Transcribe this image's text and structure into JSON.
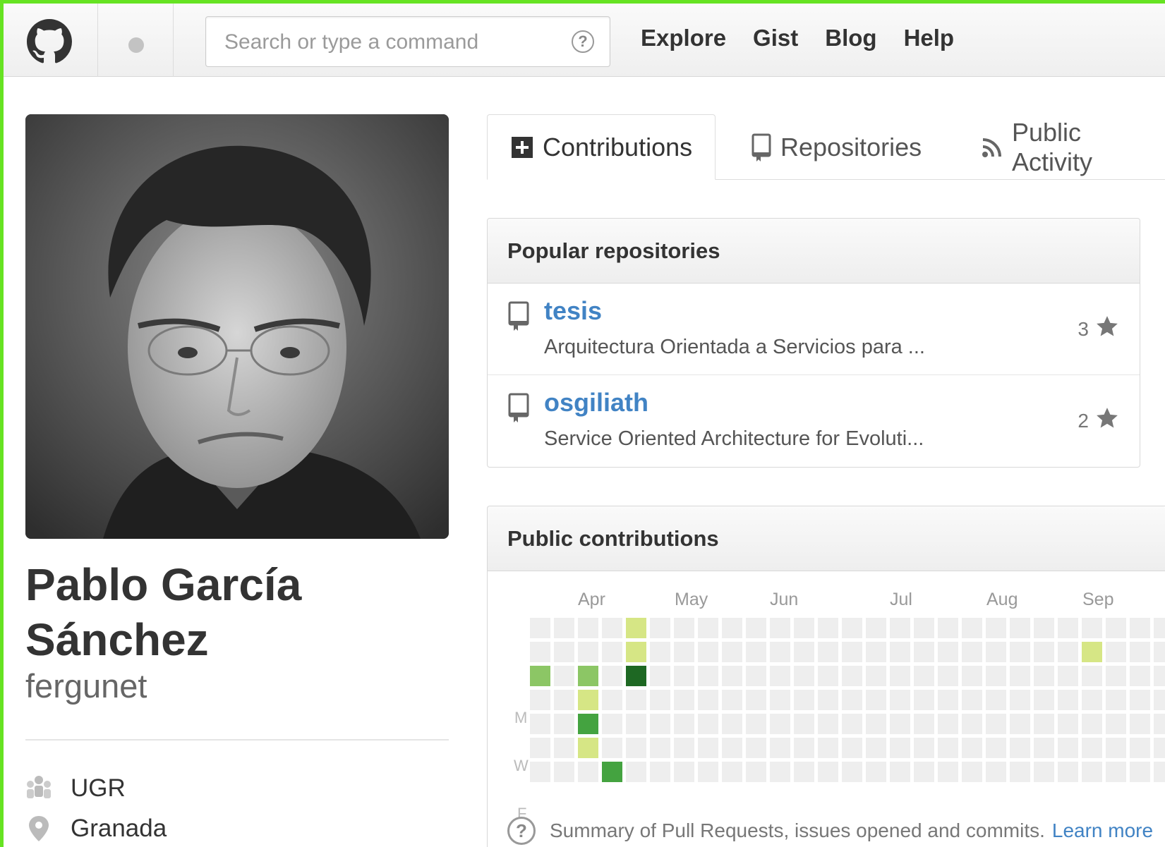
{
  "header": {
    "search_placeholder": "Search or type a command",
    "nav": [
      "Explore",
      "Gist",
      "Blog",
      "Help"
    ]
  },
  "profile": {
    "fullname_line1": "Pablo García",
    "fullname_line2": "Sánchez",
    "username": "fergunet",
    "details": [
      {
        "icon": "organization-icon",
        "text": "UGR"
      },
      {
        "icon": "location-icon",
        "text": "Granada"
      }
    ]
  },
  "tabs": [
    {
      "label": "Contributions",
      "icon": "plus-square-icon",
      "active": true
    },
    {
      "label": "Repositories",
      "icon": "repo-icon",
      "active": false
    },
    {
      "label": "Public Activity",
      "icon": "rss-icon",
      "active": false
    }
  ],
  "popular": {
    "title": "Popular repositories",
    "repos": [
      {
        "name": "tesis",
        "description": "Arquitectura Orientada a Servicios para ...",
        "stars": "3"
      },
      {
        "name": "osgiliath",
        "description": "Service Oriented Architecture for Evoluti...",
        "stars": "2"
      }
    ]
  },
  "contributions": {
    "title": "Public contributions",
    "months": [
      "Apr",
      "May",
      "Jun",
      "Jul",
      "Aug",
      "Sep"
    ],
    "day_labels": [
      "M",
      "W",
      "F"
    ],
    "summary": "Summary of Pull Requests, issues opened and commits.",
    "learn_more": "Learn more",
    "colors": {
      "empty": "#eeeeee",
      "level1": "#d6e685",
      "level2": "#8cc665",
      "level3": "#44a340",
      "level4": "#1e6823"
    },
    "active_cells": [
      {
        "week": 0,
        "day": 2,
        "level": 2
      },
      {
        "week": 2,
        "day": 2,
        "level": 2
      },
      {
        "week": 2,
        "day": 3,
        "level": 1
      },
      {
        "week": 2,
        "day": 4,
        "level": 3
      },
      {
        "week": 2,
        "day": 5,
        "level": 1
      },
      {
        "week": 3,
        "day": 6,
        "level": 3
      },
      {
        "week": 4,
        "day": 0,
        "level": 1
      },
      {
        "week": 4,
        "day": 1,
        "level": 1
      },
      {
        "week": 4,
        "day": 2,
        "level": 4
      },
      {
        "week": 23,
        "day": 1,
        "level": 1
      }
    ]
  }
}
